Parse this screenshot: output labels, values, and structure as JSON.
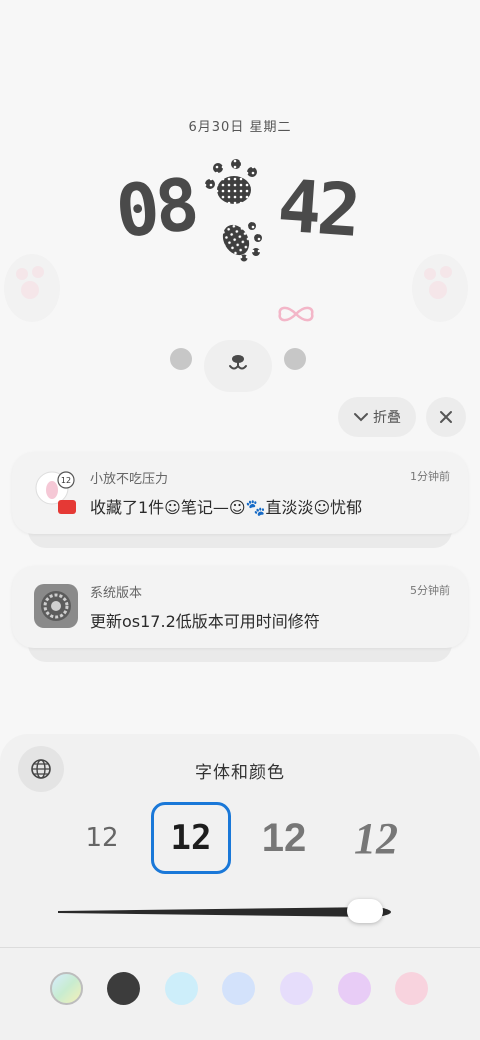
{
  "lock_screen": {
    "date": "6月30日 星期二",
    "clock_hour": "08",
    "clock_minute": "42"
  },
  "notification_controls": {
    "collapse_label": "折叠"
  },
  "notifications": [
    {
      "app": "小放不吃压力",
      "time": "1分钟前",
      "message": "收藏了1件☺笔记—☺🐾直淡淡☺忧郁"
    },
    {
      "app": "系统版本",
      "time": "5分钟前",
      "message": "更新os17.2低版本可用时间修符"
    }
  ],
  "font_sheet": {
    "title": "字体和颜色",
    "font_samples": [
      "12",
      "12",
      "12",
      "12"
    ],
    "selected_font_index": 1,
    "weight_level": 0.92,
    "colors": [
      "#c8ecd0",
      "#3c3c3c",
      "#cdeefa",
      "#d3e2fb",
      "#e6ddfb",
      "#e8ccf6",
      "#f8d3de"
    ]
  }
}
